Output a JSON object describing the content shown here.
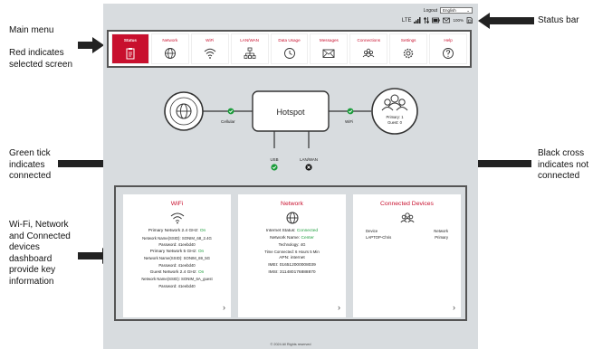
{
  "annotations": {
    "main_menu": "Main menu",
    "red_selected": [
      "Red indicates",
      "selected screen"
    ],
    "status_bar": "Status bar",
    "green_tick": [
      "Green tick",
      "indicates",
      "connected"
    ],
    "black_cross": [
      "Black cross",
      "indicates not",
      "connected"
    ],
    "dashboard": [
      "Wi-Fi, Network",
      "and Connected",
      "devices",
      "dashboard",
      "provide key",
      "information"
    ]
  },
  "header": {
    "logout": "Logout",
    "language": "English",
    "status_text": "LTE",
    "battery": "100%"
  },
  "menu": [
    {
      "label": "Status",
      "icon": "clipboard-icon",
      "selected": true
    },
    {
      "label": "Network",
      "icon": "globe-icon",
      "selected": false
    },
    {
      "label": "WiFi",
      "icon": "wifi-icon",
      "selected": false
    },
    {
      "label": "LAN/WAN",
      "icon": "lan-icon",
      "selected": false
    },
    {
      "label": "Data Usage",
      "icon": "data-usage-icon",
      "selected": false
    },
    {
      "label": "Messages",
      "icon": "envelope-icon",
      "selected": false
    },
    {
      "label": "Connections",
      "icon": "users-icon",
      "selected": false
    },
    {
      "label": "Settings",
      "icon": "gear-icon",
      "selected": false
    },
    {
      "label": "Help",
      "icon": "help-icon",
      "selected": false
    }
  ],
  "diagram": {
    "hub": "Hotspot",
    "cellular": "Cellular",
    "wifi": "WiFi",
    "primary": "Primary: 1",
    "guest": "Guest: 0",
    "usb": "USB",
    "lanwan": "LAN/WAN"
  },
  "cards": {
    "wifi": {
      "title": "WiFi",
      "lines": [
        {
          "pre": "Primary Network 2.4 GHz: ",
          "on": "On",
          "b": true
        },
        {
          "pre": "Network Name(SSID): SONIM_68_2.4G"
        },
        {
          "pre": "Password: 41eebd40"
        },
        {
          "pre": "Primary Network 5 GHz: ",
          "on": "On",
          "b": true
        },
        {
          "pre": "Network Name(SSID): SONIM_69_5G"
        },
        {
          "pre": "Password: 41eebd40"
        },
        {
          "pre": "Guest Network 2.4 GHz: ",
          "on": "On",
          "b": true
        },
        {
          "pre": "Network Name(SSID): SONIM_6A_guest"
        },
        {
          "pre": "Password: 41eebd40"
        }
      ]
    },
    "network": {
      "title": "Network",
      "lines": [
        {
          "pre": "Internet Status: ",
          "on": "Connected",
          "b": true
        },
        {
          "pre": "Network Name: ",
          "on": "Center",
          "b": true
        },
        {
          "pre": "Technology: 4G"
        },
        {
          "pre": "Time Connected: 6 Hours 5 Min"
        },
        {
          "pre": "APN: internet",
          "b": true
        },
        {
          "pre": "IMEI: 016512000008039",
          "b": true
        },
        {
          "pre": "IMSI: 311480176888870",
          "b": true
        }
      ]
    },
    "devices": {
      "title": "Connected Devices",
      "col1": "Device",
      "col2": "Network",
      "rows": [
        {
          "device": "LAPTOP-Chris",
          "network": "Primary"
        }
      ]
    }
  },
  "footer": "© 2024 All Rights reserved"
}
